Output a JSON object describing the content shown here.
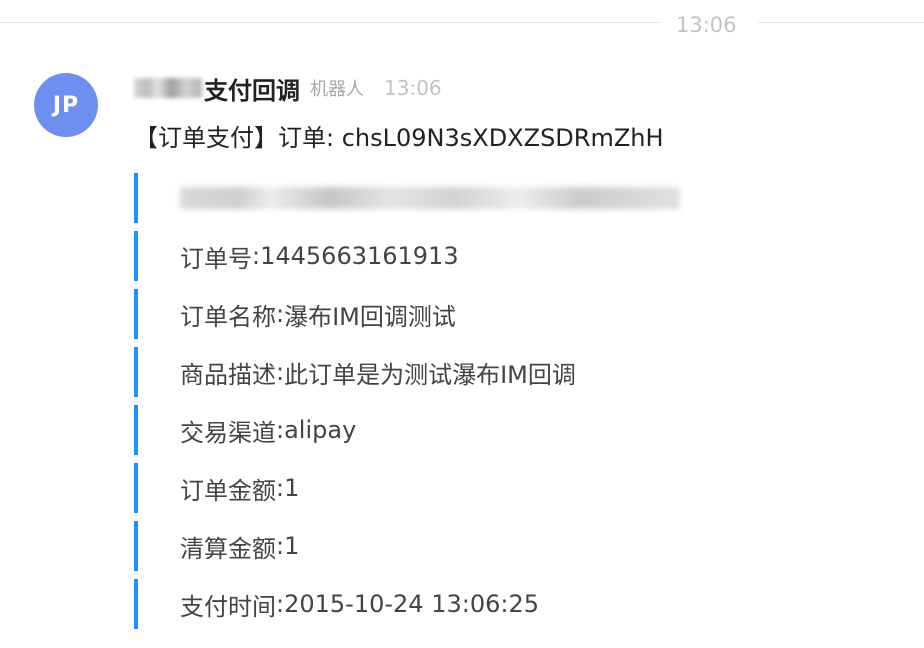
{
  "divider": {
    "time": "13:06"
  },
  "avatar": {
    "initials": "JP"
  },
  "header": {
    "sender_name": "支付回调",
    "robot_tag": "机器人",
    "time": "13:06"
  },
  "message": {
    "title": "【订单支付】订单: chsL09N3sXDXZSDRmZhH",
    "fields": [
      {
        "label": "订单号",
        "sep": " : ",
        "value": "1445663161913"
      },
      {
        "label": "订单名称",
        "sep": " : ",
        "value": "瀑布IM回调测试"
      },
      {
        "label": "商品描述",
        "sep": " : ",
        "value": "此订单是为测试瀑布IM回调"
      },
      {
        "label": "交易渠道",
        "sep": " : ",
        "value": "alipay"
      },
      {
        "label": "订单金额",
        "sep": " : ",
        "value": "1"
      },
      {
        "label": "清算金额",
        "sep": " : ",
        "value": "1"
      },
      {
        "label": "支付时间",
        "sep": " : ",
        "value": "2015-10-24 13:06:25"
      }
    ]
  },
  "colors": {
    "avatar_bg": "#6e8ef0",
    "field_bar": "#1e90ff",
    "muted_text": "#c3c3c3"
  }
}
